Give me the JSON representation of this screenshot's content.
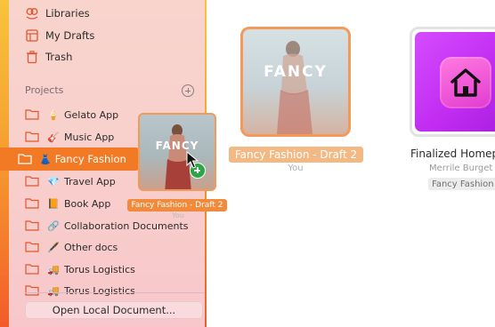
{
  "sidebar": {
    "top_items": [
      {
        "label": "Libraries",
        "icon": "library-icon"
      },
      {
        "label": "My Drafts",
        "icon": "drafts-icon"
      },
      {
        "label": "Trash",
        "icon": "trash-icon"
      }
    ],
    "projects_title": "Projects",
    "projects": [
      {
        "emoji": "🍦",
        "label": "Gelato App"
      },
      {
        "emoji": "🎸",
        "label": "Music App"
      },
      {
        "emoji": "👗",
        "label": "Fancy Fashion",
        "selected": true
      },
      {
        "emoji": "💎",
        "label": "Travel App"
      },
      {
        "emoji": "📙",
        "label": "Book App"
      },
      {
        "emoji": "🔗",
        "label": "Collaboration Documents"
      },
      {
        "emoji": "🖋️",
        "label": "Other docs"
      },
      {
        "emoji": "🚚",
        "label": "Torus Logistics"
      },
      {
        "emoji": "🚚",
        "label": "Torus Logistics"
      }
    ],
    "open_local": "Open Local Document..."
  },
  "drag_ghost": {
    "thumb_title": "FANCY",
    "label": "Fancy Fashion - Draft 2",
    "sub": "You"
  },
  "documents": [
    {
      "thumb_title": "FANCY",
      "title": "Fancy Fashion - Draft 2",
      "author": "You",
      "selected": true
    },
    {
      "title": "Finalized Homep",
      "author": "Merrile Burget",
      "project": "Fancy Fashion",
      "icon": "home-icon"
    }
  ],
  "colors": {
    "accent": "#f27a24",
    "sidebar_bg": "#f8d6e1",
    "selection_outline": "#f39a5a",
    "drop_plus": "#29a745",
    "home_card": "#c12cf0"
  }
}
